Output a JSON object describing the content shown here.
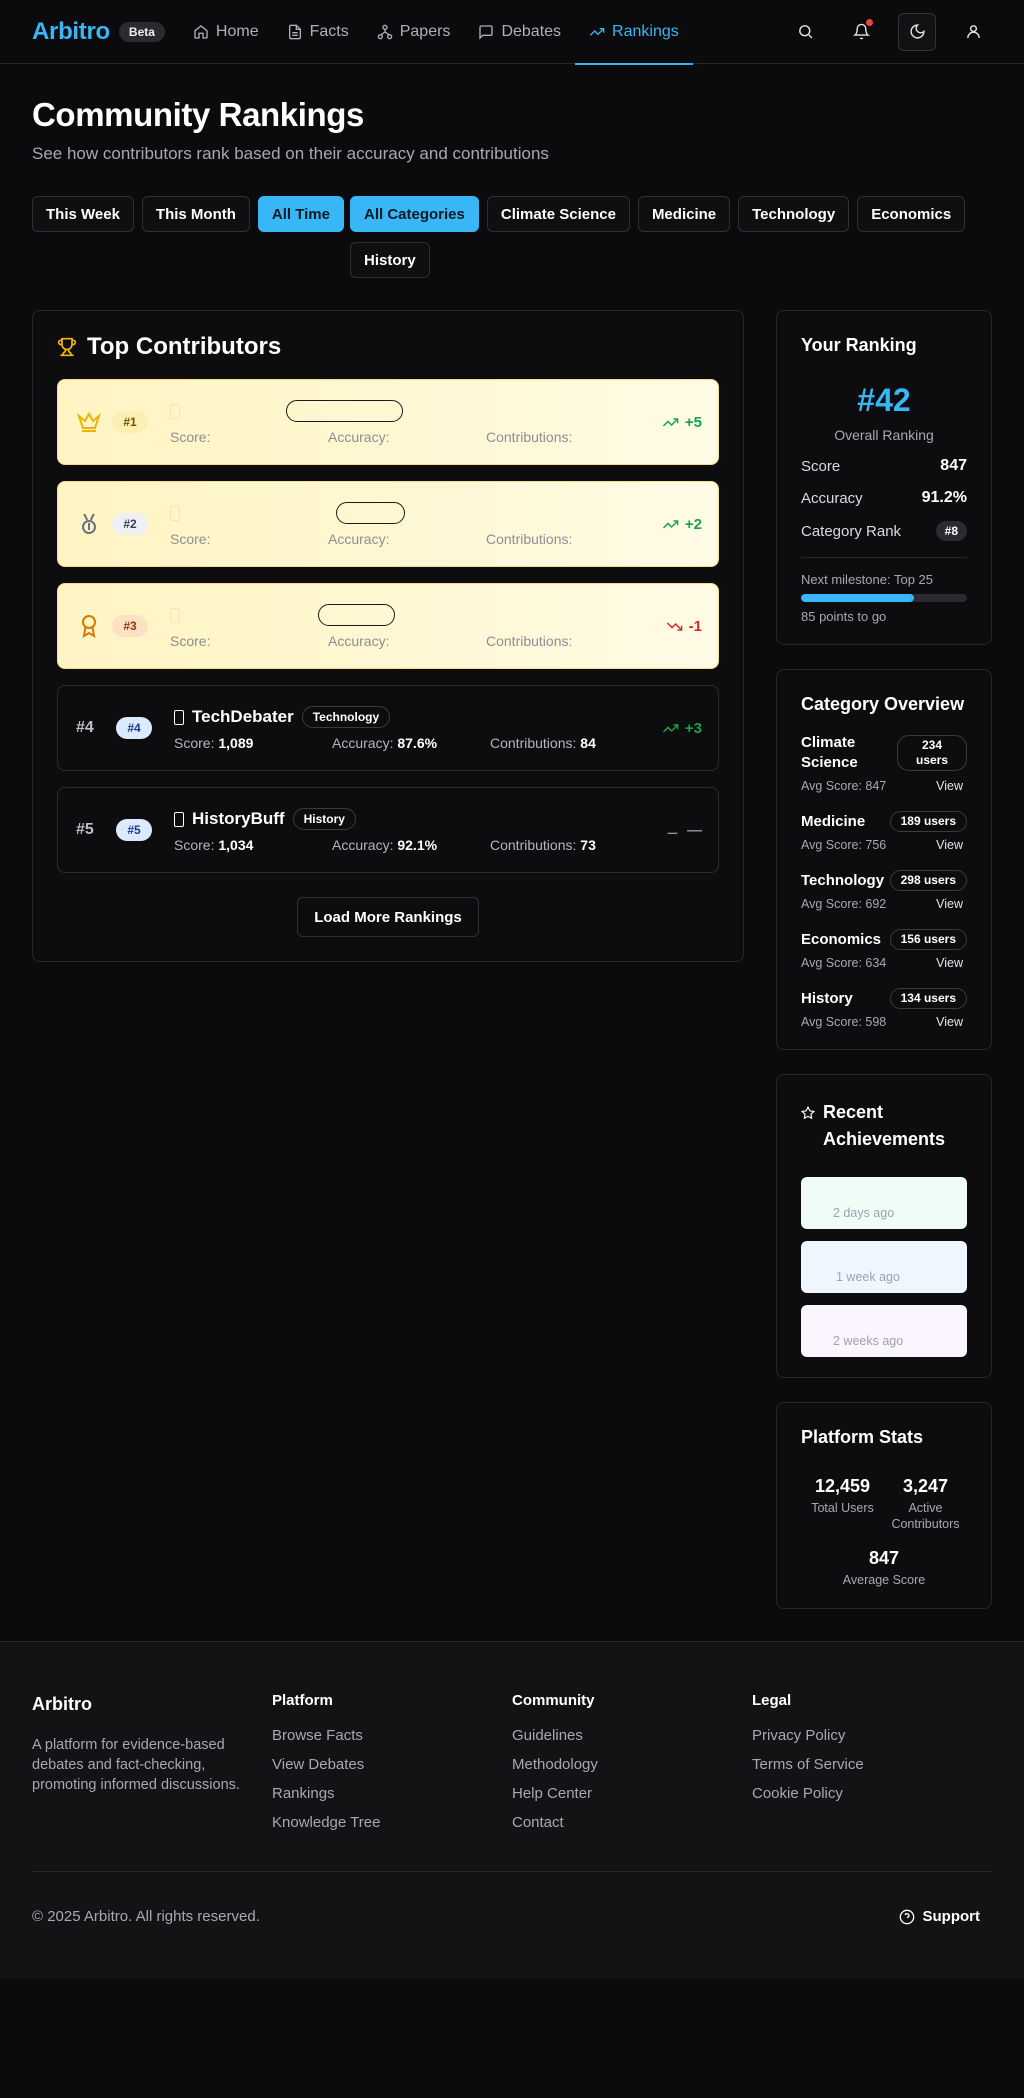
{
  "header": {
    "logo": "Arbitro",
    "beta": "Beta",
    "nav": [
      {
        "label": "Home",
        "icon": "home-icon"
      },
      {
        "label": "Facts",
        "icon": "document-icon"
      },
      {
        "label": "Papers",
        "icon": "network-icon"
      },
      {
        "label": "Debates",
        "icon": "chat-icon"
      },
      {
        "label": "Rankings",
        "icon": "trending-up-icon",
        "active": true
      }
    ]
  },
  "page": {
    "title": "Community Rankings",
    "subtitle": "See how contributors rank based on their accuracy and contributions"
  },
  "filters": {
    "time": [
      "This Week",
      "This Month",
      "All Time"
    ],
    "time_active": "All Time",
    "categories": [
      "All Categories",
      "Climate Science",
      "Medicine",
      "Technology",
      "Economics",
      "History"
    ],
    "category_active": "All Categories"
  },
  "top": {
    "title": "Top Contributors",
    "score_label": "Score:",
    "accuracy_label": "Accuracy:",
    "contrib_label": "Contributions:",
    "rows": [
      {
        "rank": "#1",
        "badge": "#1",
        "name": "",
        "category": "",
        "score": "",
        "accuracy": "",
        "contributions": "",
        "change": "+5"
      },
      {
        "rank": "#2",
        "badge": "#2",
        "name": "",
        "category": "",
        "score": "",
        "accuracy": "",
        "contributions": "",
        "change": "+2"
      },
      {
        "rank": "#3",
        "badge": "#3",
        "name": "",
        "category": "",
        "score": "",
        "accuracy": "",
        "contributions": "",
        "change": "-1"
      },
      {
        "rank": "#4",
        "badge": "#4",
        "name": "TechDebater",
        "category": "Technology",
        "score": "1,089",
        "accuracy": "87.6%",
        "contributions": "84",
        "change": "+3"
      },
      {
        "rank": "#5",
        "badge": "#5",
        "name": "HistoryBuff",
        "category": "History",
        "score": "1,034",
        "accuracy": "92.1%",
        "contributions": "73",
        "change": "—"
      }
    ],
    "load_more": "Load More Rankings"
  },
  "your_ranking": {
    "title": "Your Ranking",
    "rank": "#42",
    "rank_label": "Overall Ranking",
    "score_label": "Score",
    "score": "847",
    "accuracy_label": "Accuracy",
    "accuracy": "91.2%",
    "category_rank_label": "Category Rank",
    "category_rank": "#8",
    "milestone": "Next milestone: Top 25",
    "milestone_progress": 0.68,
    "milestone_sub": "85 points to go"
  },
  "category_overview": {
    "title": "Category Overview",
    "avg_label": "Avg Score:",
    "view": "View",
    "items": [
      {
        "name": "Climate Science",
        "users": "234 users",
        "avg": "847"
      },
      {
        "name": "Medicine",
        "users": "189 users",
        "avg": "756"
      },
      {
        "name": "Technology",
        "users": "298 users",
        "avg": "692"
      },
      {
        "name": "Economics",
        "users": "156 users",
        "avg": "634"
      },
      {
        "name": "History",
        "users": "134 users",
        "avg": "598"
      }
    ]
  },
  "achievements": {
    "title": "Recent Achievements",
    "items": [
      {
        "time": "2 days ago"
      },
      {
        "time": "1 week ago"
      },
      {
        "time": "2 weeks ago"
      }
    ]
  },
  "platform_stats": {
    "title": "Platform Stats",
    "total_users": "12,459",
    "total_users_label": "Total Users",
    "active": "3,247",
    "active_label": "Active Contributors",
    "avg": "847",
    "avg_label": "Average Score"
  },
  "footer": {
    "brand": "Arbitro",
    "desc": "A platform for evidence-based debates and fact-checking, promoting informed discussions.",
    "platform_head": "Platform",
    "platform_links": [
      "Browse Facts",
      "View Debates",
      "Rankings",
      "Knowledge Tree"
    ],
    "community_head": "Community",
    "community_links": [
      "Guidelines",
      "Methodology",
      "Help Center",
      "Contact"
    ],
    "legal_head": "Legal",
    "legal_links": [
      "Privacy Policy",
      "Terms of Service",
      "Cookie Policy"
    ],
    "copyright": "© 2025 Arbitro. All rights reserved.",
    "support": "Support"
  }
}
